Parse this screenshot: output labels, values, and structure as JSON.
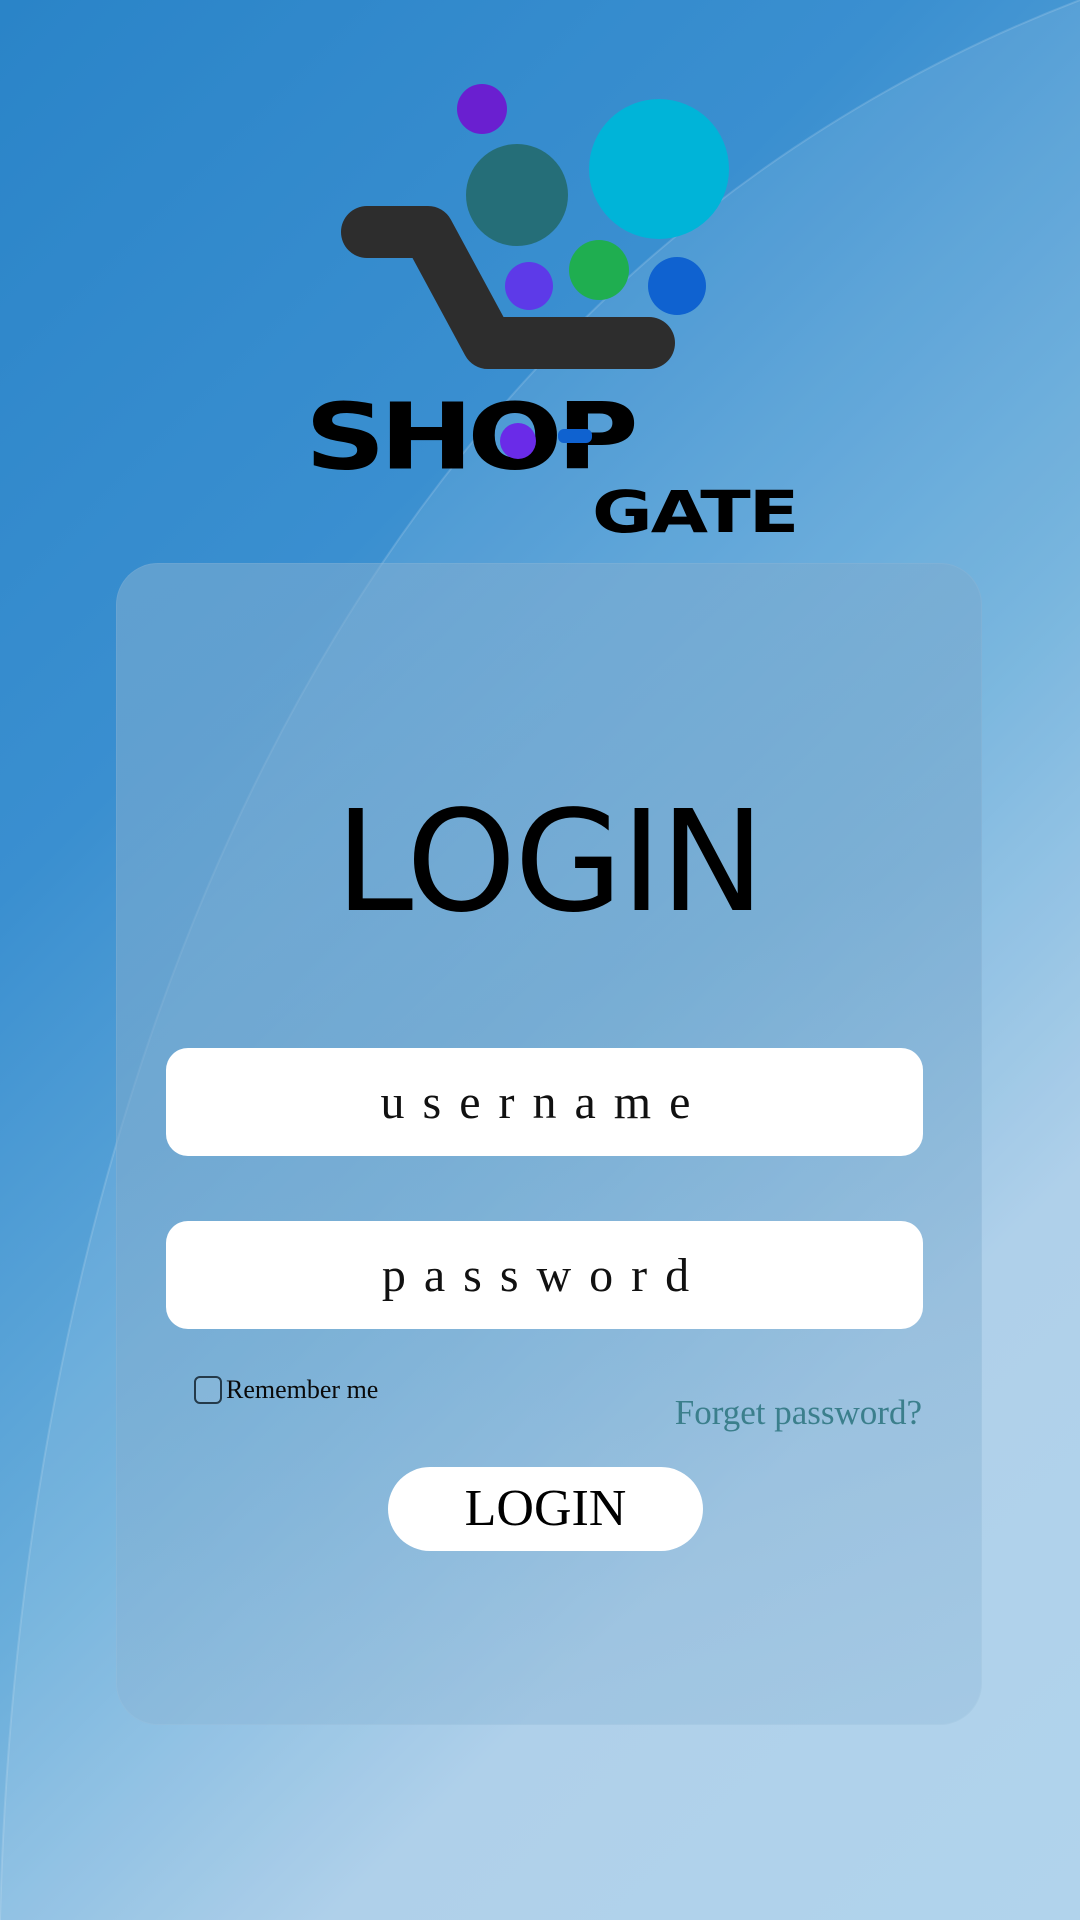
{
  "logo": {
    "word_shop": "SHOP",
    "word_gate": "GATE",
    "icon": "shopping-cart-icon"
  },
  "login_card": {
    "title": "LOGIN",
    "username": {
      "placeholder": "username",
      "value": ""
    },
    "password": {
      "placeholder": "password",
      "value": ""
    },
    "remember_me_label": "Remember me",
    "remember_me_checked": false,
    "forget_password_label": "Forget password?",
    "login_button_label": "LOGIN"
  },
  "colors": {
    "background_start": "#2a84c8",
    "background_end": "#a9cfea",
    "link": "#3b7f8c",
    "cart": "#2d2d2d",
    "bubble_purple": "#6a1fd0",
    "bubble_teal": "#256e78",
    "bubble_cyan": "#00b4d8",
    "bubble_violet": "#5d3ae8",
    "bubble_green": "#1fae50",
    "bubble_blue": "#0f62d0"
  }
}
